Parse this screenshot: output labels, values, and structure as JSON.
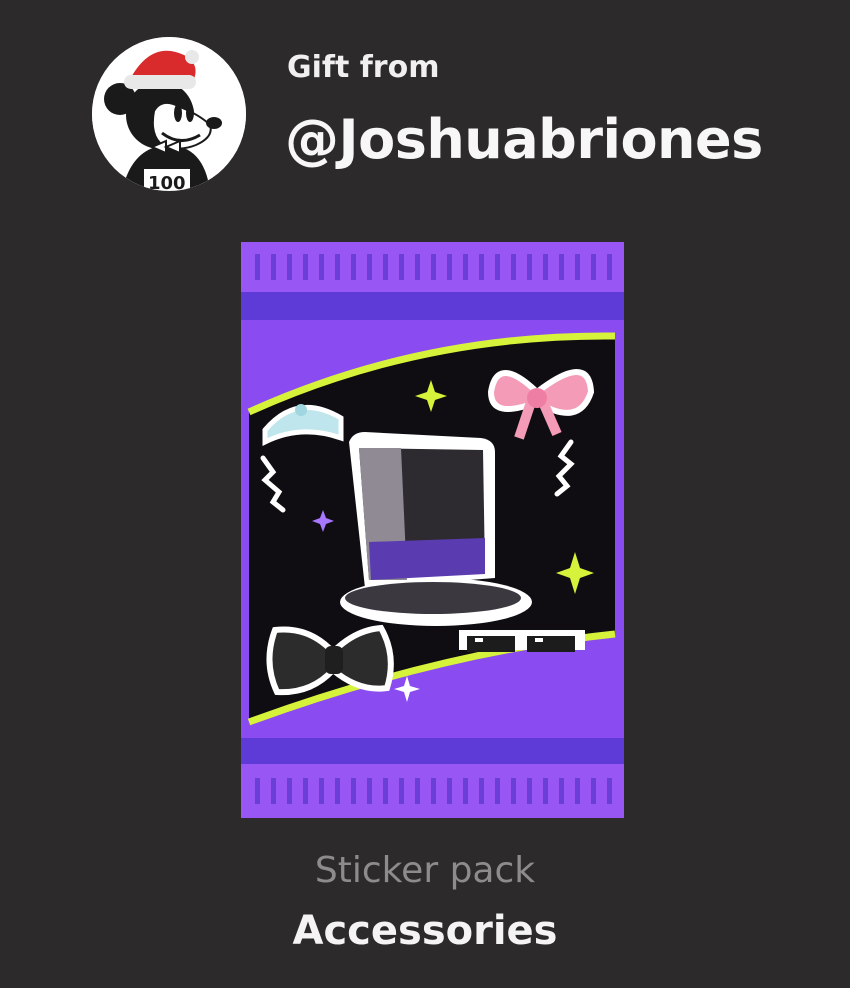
{
  "gift": {
    "from_label": "Gift from",
    "username": "@Joshuabriones",
    "avatar_icon": "mickey-santa-hat-avatar"
  },
  "pack": {
    "type_label": "Sticker pack",
    "name": "Accessories",
    "colors": {
      "purple": "#8a4bf0",
      "dark_purple": "#5e3ad6",
      "accent_lime": "#d6f23a",
      "background": "#2c2a2b"
    },
    "stickers": [
      "tiara-icon",
      "pink-bow-icon",
      "top-hat-icon",
      "bow-tie-icon",
      "pixel-sunglasses-icon",
      "sparkle-icon"
    ]
  }
}
